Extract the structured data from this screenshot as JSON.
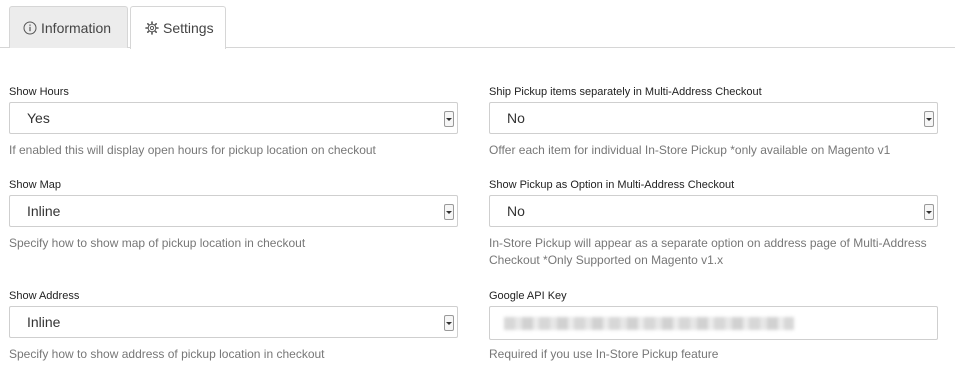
{
  "tabs": [
    {
      "label": "Information",
      "icon": "info-circle-icon"
    },
    {
      "label": "Settings",
      "icon": "gear-icon"
    }
  ],
  "fields": {
    "show_hours": {
      "label": "Show Hours",
      "value": "Yes",
      "help": "If enabled this will display open hours for pickup location on checkout"
    },
    "show_map": {
      "label": "Show Map",
      "value": "Inline",
      "help": "Specify how to show map of pickup location in checkout"
    },
    "show_address": {
      "label": "Show Address",
      "value": "Inline",
      "help": "Specify how to show address of pickup location in checkout"
    },
    "ship_separately": {
      "label": "Ship Pickup items separately in Multi-Address Checkout",
      "value": "No",
      "help": "Offer each item for individual In-Store Pickup *only available on Magento v1"
    },
    "pickup_option": {
      "label": "Show Pickup as Option in Multi-Address Checkout",
      "value": "No",
      "help_line1": "In-Store Pickup will appear as a separate option on address page of Multi-Address",
      "help_line2": "Checkout *Only Supported on Magento v1.x"
    },
    "google_api_key": {
      "label": "Google API Key",
      "help": "Required if you use In-Store Pickup feature"
    }
  }
}
